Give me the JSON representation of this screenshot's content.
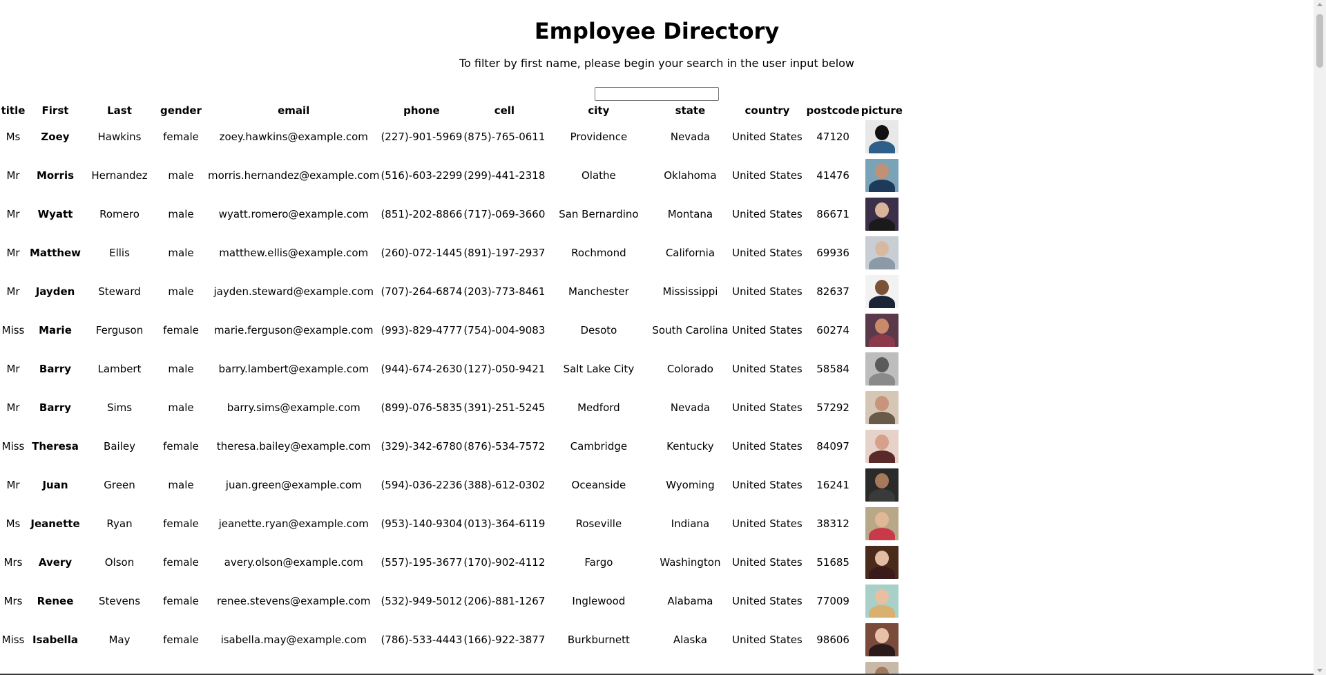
{
  "header": {
    "title": "Employee Directory",
    "subtitle": "To filter by first name, please begin your search in the user input below"
  },
  "search": {
    "value": "",
    "placeholder": ""
  },
  "table": {
    "columns": [
      "title",
      "First",
      "Last",
      "gender",
      "email",
      "phone",
      "cell",
      "city",
      "state",
      "country",
      "postcode",
      "picture"
    ],
    "rows": [
      {
        "title": "Ms",
        "first": "Zoey",
        "last": "Hawkins",
        "gender": "female",
        "email": "zoey.hawkins@example.com",
        "phone": "(227)-901-5969",
        "cell": "(875)-765-0611",
        "city": "Providence",
        "state": "Nevada",
        "country": "United States",
        "postcode": "47120",
        "picture": {
          "bg": "#e8e8e8",
          "hair": "#111111",
          "shirt": "#2d5f8a"
        }
      },
      {
        "title": "Mr",
        "first": "Morris",
        "last": "Hernandez",
        "gender": "male",
        "email": "morris.hernandez@example.com",
        "phone": "(516)-603-2299",
        "cell": "(299)-441-2318",
        "city": "Olathe",
        "state": "Oklahoma",
        "country": "United States",
        "postcode": "41476",
        "picture": {
          "bg": "#7aa3b8",
          "hair": "#c29074",
          "shirt": "#1e3a5a"
        }
      },
      {
        "title": "Mr",
        "first": "Wyatt",
        "last": "Romero",
        "gender": "male",
        "email": "wyatt.romero@example.com",
        "phone": "(851)-202-8866",
        "cell": "(717)-069-3660",
        "city": "San Bernardino",
        "state": "Montana",
        "country": "United States",
        "postcode": "86671",
        "picture": {
          "bg": "#3b2f4a",
          "hair": "#d9b49a",
          "shirt": "#1a1a1a"
        }
      },
      {
        "title": "Mr",
        "first": "Matthew",
        "last": "Ellis",
        "gender": "male",
        "email": "matthew.ellis@example.com",
        "phone": "(260)-072-1445",
        "cell": "(891)-197-2937",
        "city": "Rochmond",
        "state": "California",
        "country": "United States",
        "postcode": "69936",
        "picture": {
          "bg": "#c8ced4",
          "hair": "#d8b9a0",
          "shirt": "#8a9aa6"
        }
      },
      {
        "title": "Mr",
        "first": "Jayden",
        "last": "Steward",
        "gender": "male",
        "email": "jayden.steward@example.com",
        "phone": "(707)-264-6874",
        "cell": "(203)-773-8461",
        "city": "Manchester",
        "state": "Mississippi",
        "country": "United States",
        "postcode": "82637",
        "picture": {
          "bg": "#f2f2f2",
          "hair": "#7a5236",
          "shirt": "#1c2438"
        }
      },
      {
        "title": "Miss",
        "first": "Marie",
        "last": "Ferguson",
        "gender": "female",
        "email": "marie.ferguson@example.com",
        "phone": "(993)-829-4777",
        "cell": "(754)-004-9083",
        "city": "Desoto",
        "state": "South Carolina",
        "country": "United States",
        "postcode": "60274",
        "picture": {
          "bg": "#5a3a4a",
          "hair": "#c88a6a",
          "shirt": "#8a3a4a"
        }
      },
      {
        "title": "Mr",
        "first": "Barry",
        "last": "Lambert",
        "gender": "male",
        "email": "barry.lambert@example.com",
        "phone": "(944)-674-2630",
        "cell": "(127)-050-9421",
        "city": "Salt Lake City",
        "state": "Colorado",
        "country": "United States",
        "postcode": "58584",
        "picture": {
          "bg": "#bdbdbd",
          "hair": "#5a5a5a",
          "shirt": "#8a8a8a"
        }
      },
      {
        "title": "Mr",
        "first": "Barry",
        "last": "Sims",
        "gender": "male",
        "email": "barry.sims@example.com",
        "phone": "(899)-076-5835",
        "cell": "(391)-251-5245",
        "city": "Medford",
        "state": "Nevada",
        "country": "United States",
        "postcode": "57292",
        "picture": {
          "bg": "#d6c6b6",
          "hair": "#c9957a",
          "shirt": "#6a5a4a"
        }
      },
      {
        "title": "Miss",
        "first": "Theresa",
        "last": "Bailey",
        "gender": "female",
        "email": "theresa.bailey@example.com",
        "phone": "(329)-342-6780",
        "cell": "(876)-534-7572",
        "city": "Cambridge",
        "state": "Kentucky",
        "country": "United States",
        "postcode": "84097",
        "picture": {
          "bg": "#e6d2c8",
          "hair": "#d6a08a",
          "shirt": "#5a2a2a"
        }
      },
      {
        "title": "Mr",
        "first": "Juan",
        "last": "Green",
        "gender": "male",
        "email": "juan.green@example.com",
        "phone": "(594)-036-2236",
        "cell": "(388)-612-0302",
        "city": "Oceanside",
        "state": "Wyoming",
        "country": "United States",
        "postcode": "16241",
        "picture": {
          "bg": "#2a2a2a",
          "hair": "#a8785a",
          "shirt": "#3a3a3a"
        }
      },
      {
        "title": "Ms",
        "first": "Jeanette",
        "last": "Ryan",
        "gender": "female",
        "email": "jeanette.ryan@example.com",
        "phone": "(953)-140-9304",
        "cell": "(013)-364-6119",
        "city": "Roseville",
        "state": "Indiana",
        "country": "United States",
        "postcode": "38312",
        "picture": {
          "bg": "#b8a888",
          "hair": "#e0b898",
          "shirt": "#c83a4a"
        }
      },
      {
        "title": "Mrs",
        "first": "Avery",
        "last": "Olson",
        "gender": "female",
        "email": "avery.olson@example.com",
        "phone": "(557)-195-3677",
        "cell": "(170)-902-4112",
        "city": "Fargo",
        "state": "Washington",
        "country": "United States",
        "postcode": "51685",
        "picture": {
          "bg": "#4a2a1a",
          "hair": "#e2bca4",
          "shirt": "#3a1a1a"
        }
      },
      {
        "title": "Mrs",
        "first": "Renee",
        "last": "Stevens",
        "gender": "female",
        "email": "renee.stevens@example.com",
        "phone": "(532)-949-5012",
        "cell": "(206)-881-1267",
        "city": "Inglewood",
        "state": "Alabama",
        "country": "United States",
        "postcode": "77009",
        "picture": {
          "bg": "#a8cfc8",
          "hair": "#e8c0a0",
          "shirt": "#d8b070"
        }
      },
      {
        "title": "Miss",
        "first": "Isabella",
        "last": "May",
        "gender": "female",
        "email": "isabella.may@example.com",
        "phone": "(786)-533-4443",
        "cell": "(166)-922-3877",
        "city": "Burkburnett",
        "state": "Alaska",
        "country": "United States",
        "postcode": "98606",
        "picture": {
          "bg": "#7a4a3a",
          "hair": "#e8c0a8",
          "shirt": "#2a1a1a"
        }
      },
      {
        "title": "",
        "first": "",
        "last": "",
        "gender": "",
        "email": "",
        "phone": "",
        "cell": "",
        "city": "",
        "state": "",
        "country": "",
        "postcode": "",
        "picture": {
          "bg": "#c8b8a8",
          "hair": "#a0785a",
          "shirt": "#5a4a3a"
        }
      }
    ]
  }
}
